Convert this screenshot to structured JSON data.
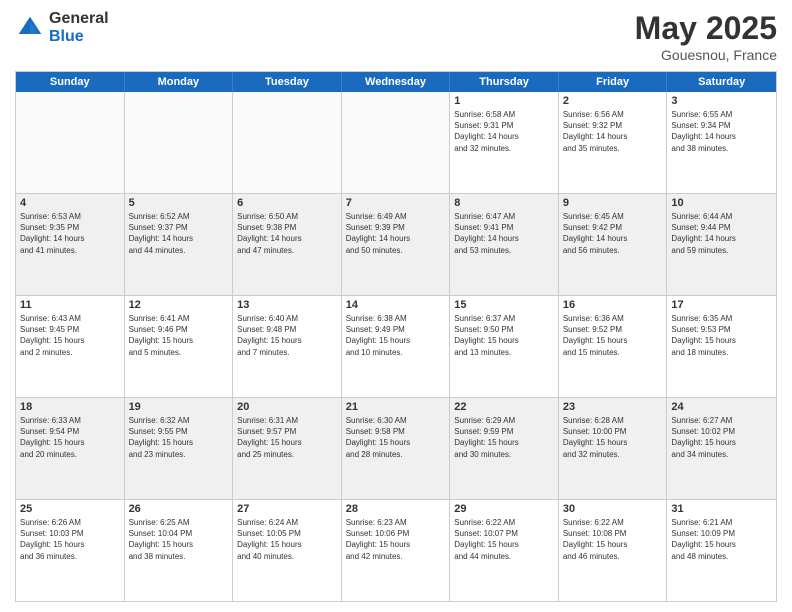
{
  "header": {
    "logo_general": "General",
    "logo_blue": "Blue",
    "title": "May 2025",
    "location": "Gouesnou, France"
  },
  "days_of_week": [
    "Sunday",
    "Monday",
    "Tuesday",
    "Wednesday",
    "Thursday",
    "Friday",
    "Saturday"
  ],
  "weeks": [
    [
      {
        "day": "",
        "info": "",
        "empty": true
      },
      {
        "day": "",
        "info": "",
        "empty": true
      },
      {
        "day": "",
        "info": "",
        "empty": true
      },
      {
        "day": "",
        "info": "",
        "empty": true
      },
      {
        "day": "1",
        "info": "Sunrise: 6:58 AM\nSunset: 9:31 PM\nDaylight: 14 hours\nand 32 minutes.",
        "empty": false
      },
      {
        "day": "2",
        "info": "Sunrise: 6:56 AM\nSunset: 9:32 PM\nDaylight: 14 hours\nand 35 minutes.",
        "empty": false
      },
      {
        "day": "3",
        "info": "Sunrise: 6:55 AM\nSunset: 9:34 PM\nDaylight: 14 hours\nand 38 minutes.",
        "empty": false
      }
    ],
    [
      {
        "day": "4",
        "info": "Sunrise: 6:53 AM\nSunset: 9:35 PM\nDaylight: 14 hours\nand 41 minutes.",
        "empty": false,
        "shaded": true
      },
      {
        "day": "5",
        "info": "Sunrise: 6:52 AM\nSunset: 9:37 PM\nDaylight: 14 hours\nand 44 minutes.",
        "empty": false,
        "shaded": true
      },
      {
        "day": "6",
        "info": "Sunrise: 6:50 AM\nSunset: 9:38 PM\nDaylight: 14 hours\nand 47 minutes.",
        "empty": false,
        "shaded": true
      },
      {
        "day": "7",
        "info": "Sunrise: 6:49 AM\nSunset: 9:39 PM\nDaylight: 14 hours\nand 50 minutes.",
        "empty": false,
        "shaded": true
      },
      {
        "day": "8",
        "info": "Sunrise: 6:47 AM\nSunset: 9:41 PM\nDaylight: 14 hours\nand 53 minutes.",
        "empty": false,
        "shaded": true
      },
      {
        "day": "9",
        "info": "Sunrise: 6:45 AM\nSunset: 9:42 PM\nDaylight: 14 hours\nand 56 minutes.",
        "empty": false,
        "shaded": true
      },
      {
        "day": "10",
        "info": "Sunrise: 6:44 AM\nSunset: 9:44 PM\nDaylight: 14 hours\nand 59 minutes.",
        "empty": false,
        "shaded": true
      }
    ],
    [
      {
        "day": "11",
        "info": "Sunrise: 6:43 AM\nSunset: 9:45 PM\nDaylight: 15 hours\nand 2 minutes.",
        "empty": false
      },
      {
        "day": "12",
        "info": "Sunrise: 6:41 AM\nSunset: 9:46 PM\nDaylight: 15 hours\nand 5 minutes.",
        "empty": false
      },
      {
        "day": "13",
        "info": "Sunrise: 6:40 AM\nSunset: 9:48 PM\nDaylight: 15 hours\nand 7 minutes.",
        "empty": false
      },
      {
        "day": "14",
        "info": "Sunrise: 6:38 AM\nSunset: 9:49 PM\nDaylight: 15 hours\nand 10 minutes.",
        "empty": false
      },
      {
        "day": "15",
        "info": "Sunrise: 6:37 AM\nSunset: 9:50 PM\nDaylight: 15 hours\nand 13 minutes.",
        "empty": false
      },
      {
        "day": "16",
        "info": "Sunrise: 6:36 AM\nSunset: 9:52 PM\nDaylight: 15 hours\nand 15 minutes.",
        "empty": false
      },
      {
        "day": "17",
        "info": "Sunrise: 6:35 AM\nSunset: 9:53 PM\nDaylight: 15 hours\nand 18 minutes.",
        "empty": false
      }
    ],
    [
      {
        "day": "18",
        "info": "Sunrise: 6:33 AM\nSunset: 9:54 PM\nDaylight: 15 hours\nand 20 minutes.",
        "empty": false,
        "shaded": true
      },
      {
        "day": "19",
        "info": "Sunrise: 6:32 AM\nSunset: 9:55 PM\nDaylight: 15 hours\nand 23 minutes.",
        "empty": false,
        "shaded": true
      },
      {
        "day": "20",
        "info": "Sunrise: 6:31 AM\nSunset: 9:57 PM\nDaylight: 15 hours\nand 25 minutes.",
        "empty": false,
        "shaded": true
      },
      {
        "day": "21",
        "info": "Sunrise: 6:30 AM\nSunset: 9:58 PM\nDaylight: 15 hours\nand 28 minutes.",
        "empty": false,
        "shaded": true
      },
      {
        "day": "22",
        "info": "Sunrise: 6:29 AM\nSunset: 9:59 PM\nDaylight: 15 hours\nand 30 minutes.",
        "empty": false,
        "shaded": true
      },
      {
        "day": "23",
        "info": "Sunrise: 6:28 AM\nSunset: 10:00 PM\nDaylight: 15 hours\nand 32 minutes.",
        "empty": false,
        "shaded": true
      },
      {
        "day": "24",
        "info": "Sunrise: 6:27 AM\nSunset: 10:02 PM\nDaylight: 15 hours\nand 34 minutes.",
        "empty": false,
        "shaded": true
      }
    ],
    [
      {
        "day": "25",
        "info": "Sunrise: 6:26 AM\nSunset: 10:03 PM\nDaylight: 15 hours\nand 36 minutes.",
        "empty": false
      },
      {
        "day": "26",
        "info": "Sunrise: 6:25 AM\nSunset: 10:04 PM\nDaylight: 15 hours\nand 38 minutes.",
        "empty": false
      },
      {
        "day": "27",
        "info": "Sunrise: 6:24 AM\nSunset: 10:05 PM\nDaylight: 15 hours\nand 40 minutes.",
        "empty": false
      },
      {
        "day": "28",
        "info": "Sunrise: 6:23 AM\nSunset: 10:06 PM\nDaylight: 15 hours\nand 42 minutes.",
        "empty": false
      },
      {
        "day": "29",
        "info": "Sunrise: 6:22 AM\nSunset: 10:07 PM\nDaylight: 15 hours\nand 44 minutes.",
        "empty": false
      },
      {
        "day": "30",
        "info": "Sunrise: 6:22 AM\nSunset: 10:08 PM\nDaylight: 15 hours\nand 46 minutes.",
        "empty": false
      },
      {
        "day": "31",
        "info": "Sunrise: 6:21 AM\nSunset: 10:09 PM\nDaylight: 15 hours\nand 48 minutes.",
        "empty": false
      }
    ]
  ]
}
